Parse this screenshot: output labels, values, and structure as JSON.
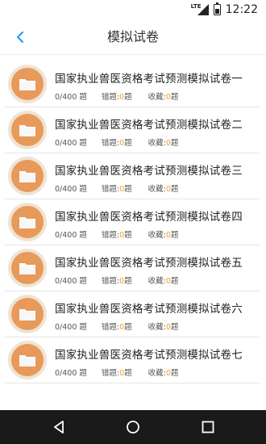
{
  "status": {
    "network": "LTE",
    "time": "12:22"
  },
  "header": {
    "title": "模拟试卷"
  },
  "stats_labels": {
    "wrong_prefix": "错题:",
    "fav_prefix": "收藏:",
    "unit": "题"
  },
  "items": [
    {
      "title": "国家执业兽医资格考试预测模拟试卷一",
      "progress": "0/400 题",
      "wrong": "0",
      "fav": "0"
    },
    {
      "title": "国家执业兽医资格考试预测模拟试卷二",
      "progress": "0/400 题",
      "wrong": "0",
      "fav": "0"
    },
    {
      "title": "国家执业兽医资格考试预测模拟试卷三",
      "progress": "0/400 题",
      "wrong": "0",
      "fav": "0"
    },
    {
      "title": "国家执业兽医资格考试预测模拟试卷四",
      "progress": "0/400 题",
      "wrong": "0",
      "fav": "0"
    },
    {
      "title": "国家执业兽医资格考试预测模拟试卷五",
      "progress": "0/400 题",
      "wrong": "0",
      "fav": "0"
    },
    {
      "title": "国家执业兽医资格考试预测模拟试卷六",
      "progress": "0/400 题",
      "wrong": "0",
      "fav": "0"
    },
    {
      "title": "国家执业兽医资格考试预测模拟试卷七",
      "progress": "0/400 题",
      "wrong": "0",
      "fav": "0"
    }
  ],
  "colors": {
    "accent": "#2196f3",
    "highlight": "#f0a030",
    "avatar": "#e79a5a",
    "avatar_ring": "#efe3d3",
    "navbar": "#1a1a1a"
  },
  "icons": {
    "back": "chevron-left-icon",
    "item": "folder-icon",
    "nav_back": "triangle-back-icon",
    "nav_home": "circle-home-icon",
    "nav_recent": "square-recent-icon"
  }
}
